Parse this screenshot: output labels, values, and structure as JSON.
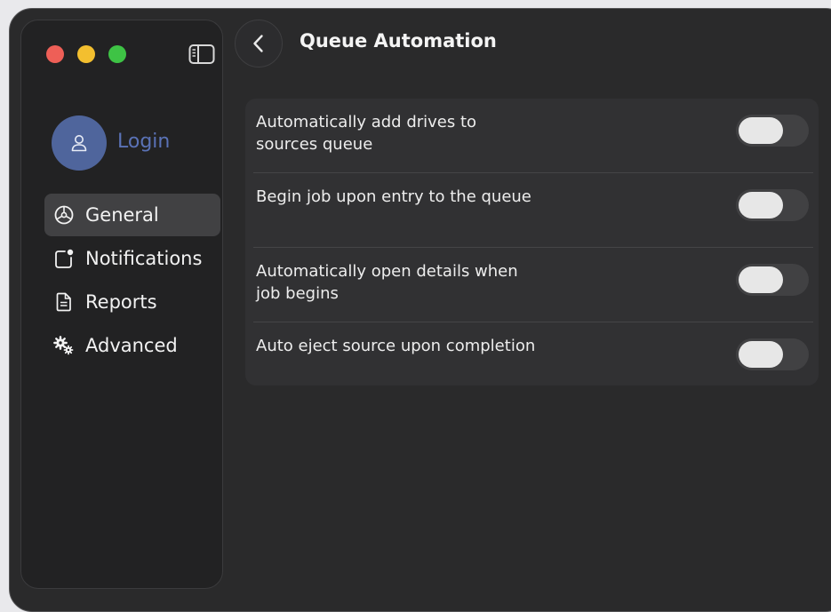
{
  "window": {
    "title": "Queue Automation"
  },
  "sidebar": {
    "login_label": "Login",
    "items": [
      {
        "label": "General",
        "icon": "gear-icon",
        "active": true
      },
      {
        "label": "Notifications",
        "icon": "notification-badge-icon",
        "active": false
      },
      {
        "label": "Reports",
        "icon": "document-icon",
        "active": false
      },
      {
        "label": "Advanced",
        "icon": "gears-icon",
        "active": false
      }
    ]
  },
  "settings": [
    {
      "label": "Automatically add drives to sources queue",
      "enabled": false
    },
    {
      "label": "Begin job upon entry to the queue",
      "enabled": false
    },
    {
      "label": "Automatically open details when job begins",
      "enabled": false
    },
    {
      "label": "Auto eject source upon completion",
      "enabled": false
    }
  ],
  "colors": {
    "window_bg": "#2a2a2b",
    "sidebar_bg": "#222223",
    "accent": "#4f659c",
    "close": "#ee5f57",
    "minimize": "#f3bf2f",
    "zoom": "#3ec345"
  }
}
